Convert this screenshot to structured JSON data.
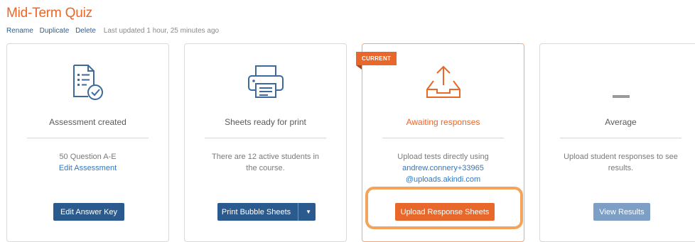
{
  "page": {
    "title": "Mid-Term Quiz",
    "actions": {
      "rename": "Rename",
      "duplicate": "Duplicate",
      "delete": "Delete"
    },
    "last_updated": "Last updated 1 hour, 25 minutes ago"
  },
  "cards": [
    {
      "icon": "document-check-icon",
      "state": "Assessment created",
      "desc_text": "50 Question A-E",
      "desc_link": "Edit Assessment",
      "button": "Edit Answer Key"
    },
    {
      "icon": "printer-icon",
      "state": "Sheets ready for print",
      "desc_text": "There are 12 active students in the course.",
      "button": "Print Bubble Sheets"
    },
    {
      "badge": "CURRENT",
      "icon": "upload-tray-icon",
      "state": "Awaiting responses",
      "desc_text": "Upload tests directly using",
      "desc_link1": "andrew.connery+33965",
      "desc_link2": "@uploads.akindi.com",
      "button": "Upload Response Sheets"
    },
    {
      "icon": "dash-icon",
      "state": "Average",
      "desc_text": "Upload student responses to see results.",
      "button": "View Results"
    }
  ],
  "colors": {
    "accent": "#e8672a",
    "primary": "#2b5a8f",
    "link": "#2f78c4",
    "highlight": "#f4a45a"
  }
}
